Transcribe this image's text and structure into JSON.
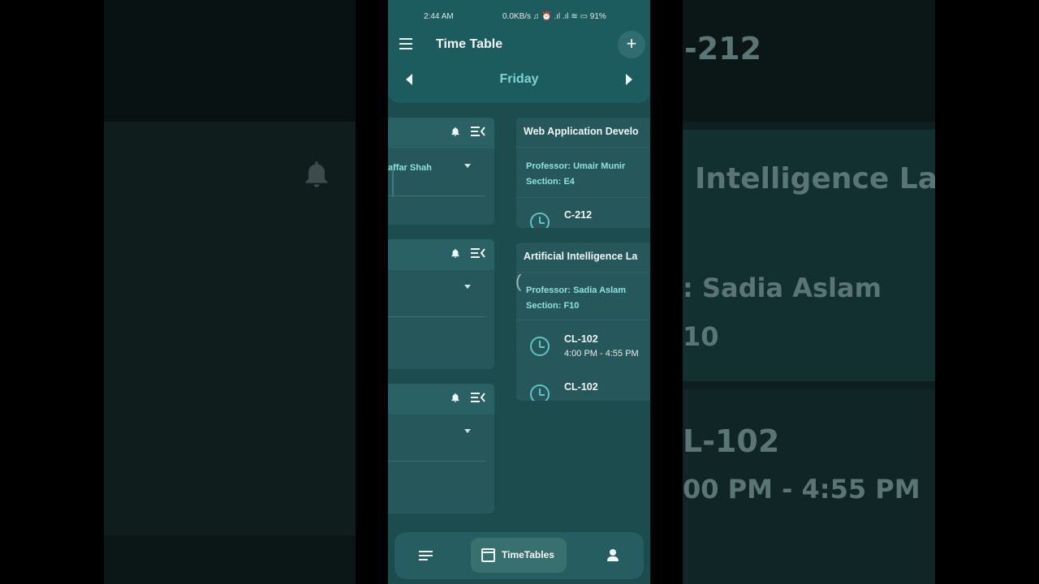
{
  "status_bar": {
    "time": "2:44 AM",
    "indicators": "0.0KB/s ♫ ⏰ .ıl .ıl ≋ ▭ 91%"
  },
  "app": {
    "title": "Time Table",
    "add_label": "+",
    "day": "Friday"
  },
  "left_cards": [
    {
      "professor": "affar Shah"
    },
    {
      "professor": ""
    },
    {
      "professor": ""
    }
  ],
  "right_cards": [
    {
      "title": "Web Application Develo",
      "professor": "Professor: Umair Munir",
      "section": "Section: E4",
      "slots": [
        {
          "room": "C-212",
          "time": ""
        }
      ]
    },
    {
      "title": "Artificial Intelligence La",
      "professor": "Professor: Sadia Aslam",
      "section": "Section: F10",
      "slots": [
        {
          "room": "CL-102",
          "time": "4:00 PM - 4:55 PM"
        },
        {
          "room": "CL-102",
          "time": ""
        }
      ]
    }
  ],
  "bottom_nav": {
    "active_label": "TimeTables"
  },
  "background": {
    "right_texts": [
      "-212",
      "Intelligence La",
      ": Sadia Aslam",
      "10",
      "L-102",
      "00 PM - 4:55 PM"
    ]
  },
  "colors": {
    "accent": "#7fd3d4",
    "surface": "#26585b",
    "header": "#1c5c5f"
  }
}
